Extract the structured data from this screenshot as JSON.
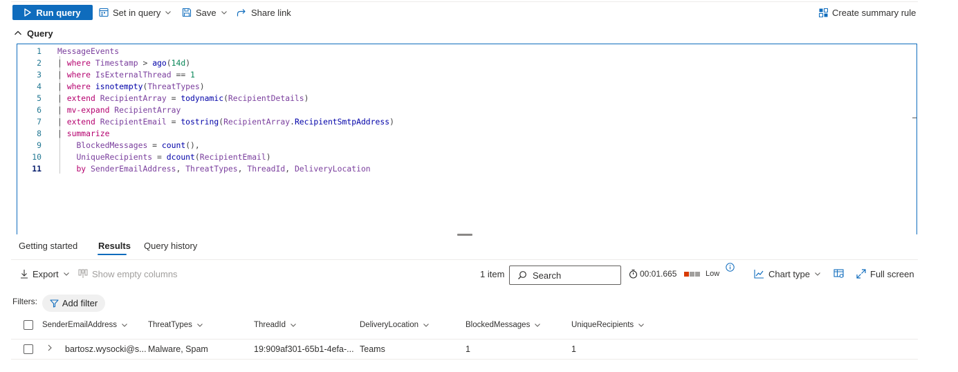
{
  "toolbar": {
    "run_query": "Run query",
    "set_in_query": "Set in query",
    "save": "Save",
    "share_link": "Share link",
    "create_summary_rule": "Create summary rule"
  },
  "query": {
    "heading": "Query",
    "lines": [
      {
        "n": "1",
        "tokens": [
          [
            "tb",
            "MessageEvents"
          ]
        ]
      },
      {
        "n": "2",
        "tokens": [
          [
            "op",
            "| "
          ],
          [
            "kw",
            "where "
          ],
          [
            "tb",
            "Timestamp"
          ],
          [
            "op",
            " > "
          ],
          [
            "fn",
            "ago"
          ],
          [
            "op",
            "("
          ],
          [
            "num",
            "14d"
          ],
          [
            "op",
            ")"
          ]
        ]
      },
      {
        "n": "3",
        "tokens": [
          [
            "op",
            "| "
          ],
          [
            "kw",
            "where "
          ],
          [
            "tb",
            "IsExternalThread"
          ],
          [
            "op",
            " == "
          ],
          [
            "num",
            "1"
          ]
        ]
      },
      {
        "n": "4",
        "tokens": [
          [
            "op",
            "| "
          ],
          [
            "kw",
            "where "
          ],
          [
            "fn",
            "isnotempty"
          ],
          [
            "op",
            "("
          ],
          [
            "tb",
            "ThreatTypes"
          ],
          [
            "op",
            ")"
          ]
        ]
      },
      {
        "n": "5",
        "tokens": [
          [
            "op",
            "| "
          ],
          [
            "kw",
            "extend "
          ],
          [
            "tb",
            "RecipientArray"
          ],
          [
            "op",
            " = "
          ],
          [
            "fn",
            "todynamic"
          ],
          [
            "op",
            "("
          ],
          [
            "tb",
            "RecipientDetails"
          ],
          [
            "op",
            ")"
          ]
        ]
      },
      {
        "n": "6",
        "tokens": [
          [
            "op",
            "| "
          ],
          [
            "kw",
            "mv-expand "
          ],
          [
            "tb",
            "RecipientArray"
          ]
        ]
      },
      {
        "n": "7",
        "tokens": [
          [
            "op",
            "| "
          ],
          [
            "kw",
            "extend "
          ],
          [
            "tb",
            "RecipientEmail"
          ],
          [
            "op",
            " = "
          ],
          [
            "fn",
            "tostring"
          ],
          [
            "op",
            "("
          ],
          [
            "tb",
            "RecipientArray"
          ],
          [
            "op",
            "."
          ],
          [
            "fn",
            "RecipientSmtpAddress"
          ],
          [
            "op",
            ")"
          ]
        ]
      },
      {
        "n": "8",
        "tokens": [
          [
            "op",
            "| "
          ],
          [
            "kw",
            "summarize"
          ]
        ]
      },
      {
        "n": "9",
        "tokens": [
          [
            "op",
            "    "
          ],
          [
            "tb",
            "BlockedMessages"
          ],
          [
            "op",
            " = "
          ],
          [
            "fn",
            "count"
          ],
          [
            "op",
            "(),"
          ]
        ]
      },
      {
        "n": "10",
        "tokens": [
          [
            "op",
            "    "
          ],
          [
            "tb",
            "UniqueRecipients"
          ],
          [
            "op",
            " = "
          ],
          [
            "fn",
            "dcount"
          ],
          [
            "op",
            "("
          ],
          [
            "tb",
            "RecipientEmail"
          ],
          [
            "op",
            ")"
          ]
        ]
      },
      {
        "n": "11",
        "tokens": [
          [
            "op",
            "    "
          ],
          [
            "kw",
            "by "
          ],
          [
            "tb",
            "SenderEmailAddress"
          ],
          [
            "op",
            ", "
          ],
          [
            "tb",
            "ThreatTypes"
          ],
          [
            "op",
            ", "
          ],
          [
            "tb",
            "ThreadId"
          ],
          [
            "op",
            ", "
          ],
          [
            "tb",
            "DeliveryLocation"
          ]
        ]
      }
    ]
  },
  "tabs": [
    "Getting started",
    "Results",
    "Query history"
  ],
  "results_toolbar": {
    "export": "Export",
    "show_empty_columns": "Show empty columns",
    "item_count": "1 item",
    "search_placeholder": "Search",
    "duration": "00:01.665",
    "severity": "Low",
    "chart_type": "Chart type",
    "full_screen": "Full screen"
  },
  "filters": {
    "label": "Filters:",
    "add_filter": "Add filter"
  },
  "table": {
    "columns": [
      "SenderEmailAddress",
      "ThreatTypes",
      "ThreadId",
      "DeliveryLocation",
      "BlockedMessages",
      "UniqueRecipients"
    ],
    "rows": [
      [
        "bartosz.wysocki@s...",
        "Malware, Spam",
        "19:909af301-65b1-4efa-...",
        "Teams",
        "1",
        "1"
      ]
    ]
  },
  "colors": {
    "accent": "#0f6cbd",
    "keyword": "#b5006e",
    "table_name": "#7a3e9d",
    "function": "#0000a8",
    "number": "#098658",
    "severity_orange": "#d83b01",
    "severity_grey": "#a19f9d"
  }
}
